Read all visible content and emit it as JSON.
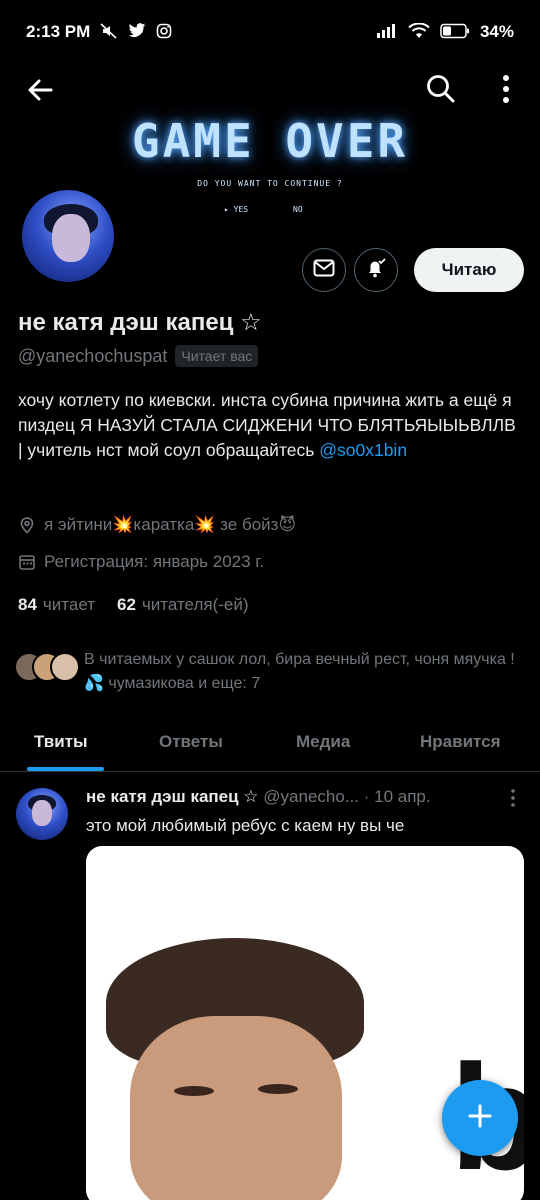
{
  "status_bar": {
    "time": "2:13 PM",
    "battery": "34%",
    "icons": [
      "mute-icon",
      "twitter-icon",
      "instagram-icon",
      "signal-icon",
      "wifi-icon",
      "battery-icon"
    ]
  },
  "banner": {
    "title": "GAME OVER",
    "subtitle": "DO YOU WANT TO CONTINUE ?",
    "option_yes": "▸ YES",
    "option_no": "NO"
  },
  "profile": {
    "name": "не катя дэш капец ☆",
    "handle": "@yanechochuspat",
    "follows_you": "Читает вас",
    "follow_button": "Читаю",
    "bio_text": "хочу котлету по киевски. инста субина причина жить а ещё я пиздец Я НАЗУЙ СТАЛА СИДЖЕНИ ЧТО БЛЯТЬЯЫЫЬВЛЛВ | учитель нст мой соул обращайтесь ",
    "bio_link": "@so0x1bin",
    "location": "я эйтини💥каратка💥 зе бойз😈",
    "joined": "Регистрация: январь 2023 г.",
    "following_count": "84",
    "following_label": "читает",
    "followers_count": "62",
    "followers_label": "читателя(-ей)",
    "known_followers": "В читаемых у сашок лол, бира вечный рест, чоня мяучка ! 💦 чумазикова и еще: 7"
  },
  "tabs": [
    {
      "label": "Твиты",
      "active": true
    },
    {
      "label": "Ответы",
      "active": false
    },
    {
      "label": "Медиа",
      "active": false
    },
    {
      "label": "Нравится",
      "active": false
    }
  ],
  "tweet": {
    "name": "не катя дэш капец ☆",
    "handle": "@yanecho...",
    "date": "· 10 апр.",
    "text": "это мой любимый ребус с каем ну вы че",
    "media_letter": "b"
  },
  "colors": {
    "background": "#000000",
    "accent": "#1d9bf0",
    "secondary_text": "#71767b",
    "primary_text": "#e7e9ea",
    "banner_glow": "#5aa9ff"
  }
}
